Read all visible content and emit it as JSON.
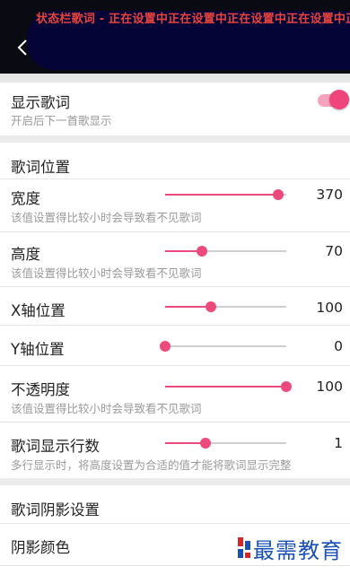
{
  "status_marquee": "状态栏歌词 - 正在设置中正在设置中正在设置中正在设置中正在设置中",
  "show_lyrics": {
    "title": "显示歌词",
    "subtitle": "开启后下一首歌显示",
    "enabled": true
  },
  "lyrics_position": {
    "header": "歌词位置",
    "rows": [
      {
        "label": "宽度",
        "hint": "该值设置得比较小时会导致看不见歌词",
        "value": "370",
        "fraction": 0.93
      },
      {
        "label": "高度",
        "hint": "该值设置得比较小时会导致看不见歌词",
        "value": "70",
        "fraction": 0.3
      },
      {
        "label": "X轴位置",
        "hint": "",
        "value": "100",
        "fraction": 0.38
      },
      {
        "label": "Y轴位置",
        "hint": "",
        "value": "0",
        "fraction": 0.0
      },
      {
        "label": "不透明度",
        "hint": "该值设置得比较小时会导致看不见歌词",
        "value": "100",
        "fraction": 1.0
      },
      {
        "label": "歌词显示行数",
        "hint": "多行显示时，将高度设置为合适的值才能将歌词显示完整",
        "value": "1",
        "fraction": 0.33
      }
    ]
  },
  "shadow_settings": {
    "header": "歌词阴影设置",
    "color_label": "阴影颜色"
  },
  "watermark": "最需教育",
  "colors": {
    "accent": "#ec4a7d",
    "toggle_track": "#f6a3bd",
    "marquee": "#e8443c",
    "watermark": "#1a4fb5"
  }
}
